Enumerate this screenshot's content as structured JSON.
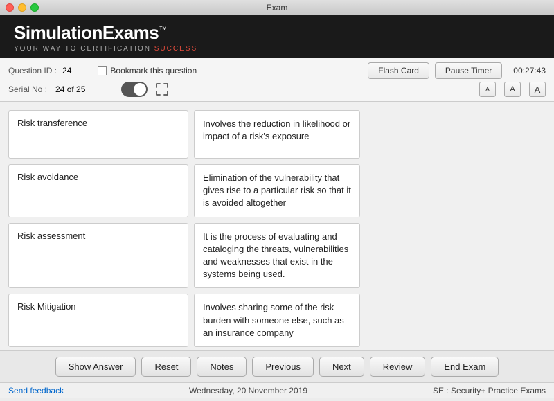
{
  "window": {
    "title": "Exam"
  },
  "branding": {
    "name": "SimulationExams",
    "trademark": "™",
    "tagline_pre": "YOUR WAY TO CERTIFICATION ",
    "tagline_highlight": "SUCCESS"
  },
  "toolbar": {
    "question_id_label": "Question ID :",
    "question_id_value": "24",
    "serial_no_label": "Serial No :",
    "serial_no_value": "24 of 25",
    "bookmark_label": "Bookmark this question",
    "flash_card_label": "Flash Card",
    "pause_timer_label": "Pause Timer",
    "timer_value": "00:27:43",
    "font_a_small": "A",
    "font_a_medium": "A",
    "font_a_large": "A"
  },
  "flashcards": [
    {
      "term": "Risk transference",
      "definition": "Involves the reduction in likelihood or impact of a risk's exposure"
    },
    {
      "term": "Risk avoidance",
      "definition": "Elimination of the vulnerability that gives rise to a particular risk so that it is avoided altogether"
    },
    {
      "term": "Risk assessment",
      "definition": "It is the process of evaluating and cataloging the threats, vulnerabilities and weaknesses that exist in the systems being used."
    },
    {
      "term": "Risk Mitigation",
      "definition": "Involves sharing some of the risk burden with someone else, such as an insurance company"
    }
  ],
  "buttons": {
    "show_answer": "Show Answer",
    "reset": "Reset",
    "notes": "Notes",
    "previous": "Previous",
    "next": "Next",
    "review": "Review",
    "end_exam": "End Exam"
  },
  "status": {
    "feedback": "Send feedback",
    "date": "Wednesday, 20 November 2019",
    "exam_name": "SE : Security+ Practice Exams"
  }
}
